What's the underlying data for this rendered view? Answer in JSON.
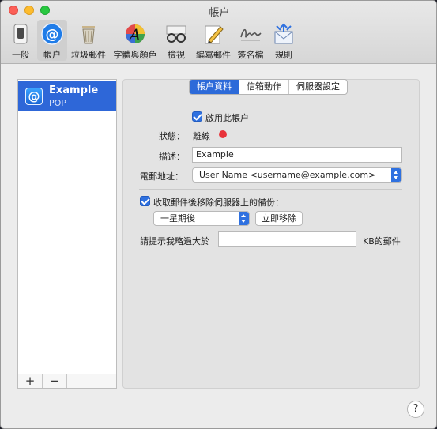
{
  "window": {
    "title": "帳户"
  },
  "toolbar": {
    "items": [
      {
        "label": "一般",
        "icon": "general-switch-icon"
      },
      {
        "label": "帳户",
        "icon": "at-sign-icon",
        "selected": true
      },
      {
        "label": "垃圾郵件",
        "icon": "trash-bin-icon"
      },
      {
        "label": "字體與顏色",
        "icon": "font-color-icon"
      },
      {
        "label": "檢視",
        "icon": "glasses-icon"
      },
      {
        "label": "編寫郵件",
        "icon": "compose-pencil-icon"
      },
      {
        "label": "簽名檔",
        "icon": "signature-icon"
      },
      {
        "label": "規則",
        "icon": "rules-envelope-icon"
      }
    ]
  },
  "accounts": [
    {
      "name": "Example",
      "type": "POP"
    }
  ],
  "account_list_controls": {
    "add": "+",
    "remove": "−"
  },
  "tabs": [
    {
      "label": "帳户資料",
      "active": true
    },
    {
      "label": "信箱動作",
      "active": false
    },
    {
      "label": "伺服器設定",
      "active": false
    }
  ],
  "form": {
    "enable_account_label": "啟用此帳户",
    "enable_account_checked": true,
    "status_label": "狀態：",
    "status_value": "離線",
    "status_color": "#e8333a",
    "description_label": "描述：",
    "description_value": "Example",
    "email_label": "電郵地址：",
    "email_value": "User Name <username@example.com>",
    "remove_after_label": "收取郵件後移除伺服器上的備份：",
    "remove_after_checked": true,
    "remove_period_value": "一星期後",
    "remove_now_button": "立即移除",
    "warn_label": "請提示我略過大於",
    "warn_value": "",
    "warn_unit": "KB的郵件"
  },
  "help": {
    "label": "?"
  },
  "colors": {
    "accent": "#2c6ad9",
    "selection": "#2e67d8"
  }
}
